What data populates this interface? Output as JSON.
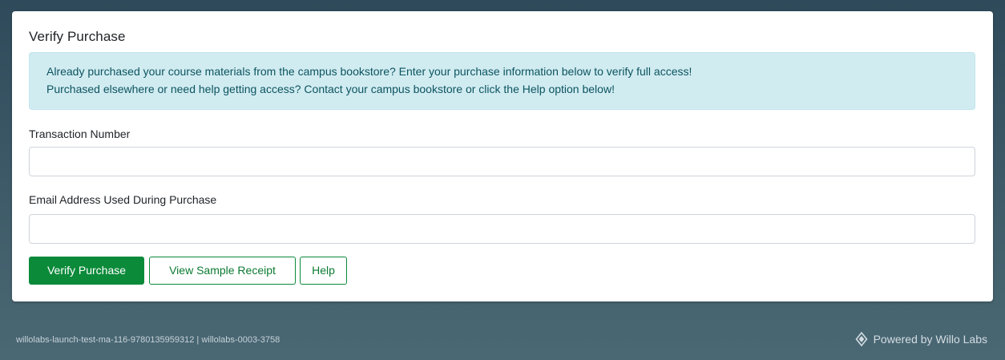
{
  "card": {
    "title": "Verify Purchase"
  },
  "alert": {
    "line1": "Already purchased your course materials from the campus bookstore? Enter your purchase information below to verify full access!",
    "line2": "Purchased elsewhere or need help getting access? Contact your campus bookstore or click the Help option below!"
  },
  "form": {
    "transaction_label": "Transaction Number",
    "transaction_value": "",
    "email_label": "Email Address Used During Purchase",
    "email_value": ""
  },
  "buttons": {
    "verify": "Verify Purchase",
    "sample_receipt": "View Sample Receipt",
    "help": "Help"
  },
  "footer": {
    "launch_id": "willolabs-launch-test-ma-116-9780135959312 | willolabs-0003-3758",
    "powered_by": "Powered by Willo Labs",
    "icon": "willo-labs-logo-icon"
  },
  "colors": {
    "primary": "#0b8a3a",
    "alert_bg": "#d1ecf1",
    "alert_text": "#0c5460"
  }
}
